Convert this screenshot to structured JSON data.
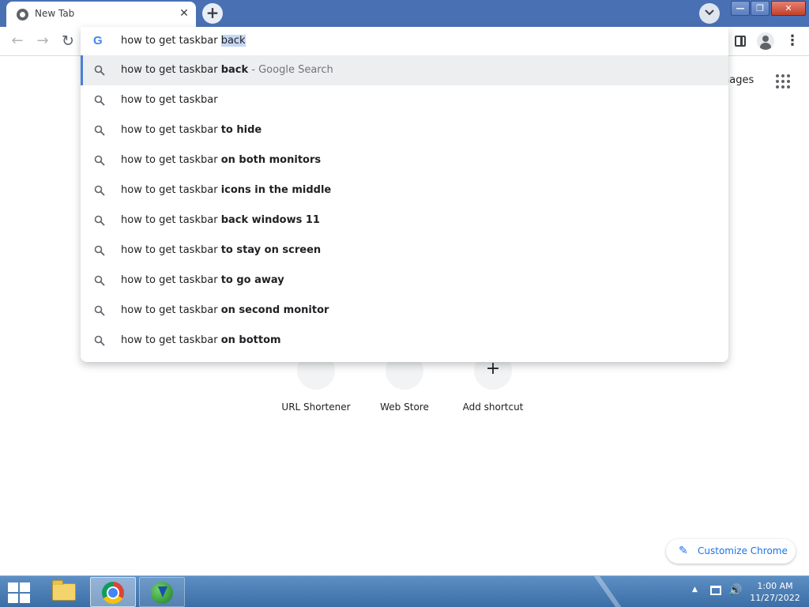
{
  "browser": {
    "tab": {
      "title": "New Tab",
      "close_glyph": "✕"
    },
    "new_tab_glyph": "+",
    "window_controls": {
      "minimize": "—",
      "maximize": "❐",
      "close": "✕"
    }
  },
  "toolbar": {
    "back_glyph": "←",
    "forward_glyph": "→",
    "reload_glyph": "↻",
    "menu_glyph": "⋮"
  },
  "omnibox": {
    "logo": "G",
    "typed_text": "how to get taskbar ",
    "autocomplete_selected": "back"
  },
  "suggestions": [
    {
      "prefix": "how to get taskbar ",
      "bold": "back",
      "separator": " - ",
      "suffix": "Google Search",
      "selected": true
    },
    {
      "prefix": "how to get taskbar",
      "bold": "",
      "selected": false
    },
    {
      "prefix": "how to get taskbar ",
      "bold": "to hide",
      "selected": false
    },
    {
      "prefix": "how to get taskbar ",
      "bold": "on both monitors",
      "selected": false
    },
    {
      "prefix": "how to get taskbar ",
      "bold": "icons in the middle",
      "selected": false
    },
    {
      "prefix": "how to get taskbar ",
      "bold": "back windows 11",
      "selected": false
    },
    {
      "prefix": "how to get taskbar ",
      "bold": "to stay on screen",
      "selected": false
    },
    {
      "prefix": "how to get taskbar ",
      "bold": "to go away",
      "selected": false
    },
    {
      "prefix": "how to get taskbar ",
      "bold": "on second monitor",
      "selected": false
    },
    {
      "prefix": "how to get taskbar ",
      "bold": "on bottom",
      "selected": false
    }
  ],
  "ntp": {
    "images_link": "nages",
    "shortcuts": [
      {
        "label": "URL Shortener",
        "icon": "link-icon"
      },
      {
        "label": "Web Store",
        "icon": "web-store-icon"
      },
      {
        "label": "Add shortcut",
        "icon": "plus-icon",
        "glyph": "+"
      }
    ],
    "customize_label": "Customize Chrome",
    "customize_glyph": "✎"
  },
  "taskbar": {
    "apps": [
      "file-explorer",
      "google-chrome",
      "internet-download-manager"
    ],
    "tray_arrow_glyph": "▲",
    "volume_glyph": "🔊",
    "clock": {
      "time": "1:00 AM",
      "date": "11/27/2022"
    }
  },
  "colors": {
    "titlebar": "#4a70b4",
    "accent": "#1a73e8",
    "selection": "#c6d7f5",
    "taskbar": "#3b6ea6"
  }
}
